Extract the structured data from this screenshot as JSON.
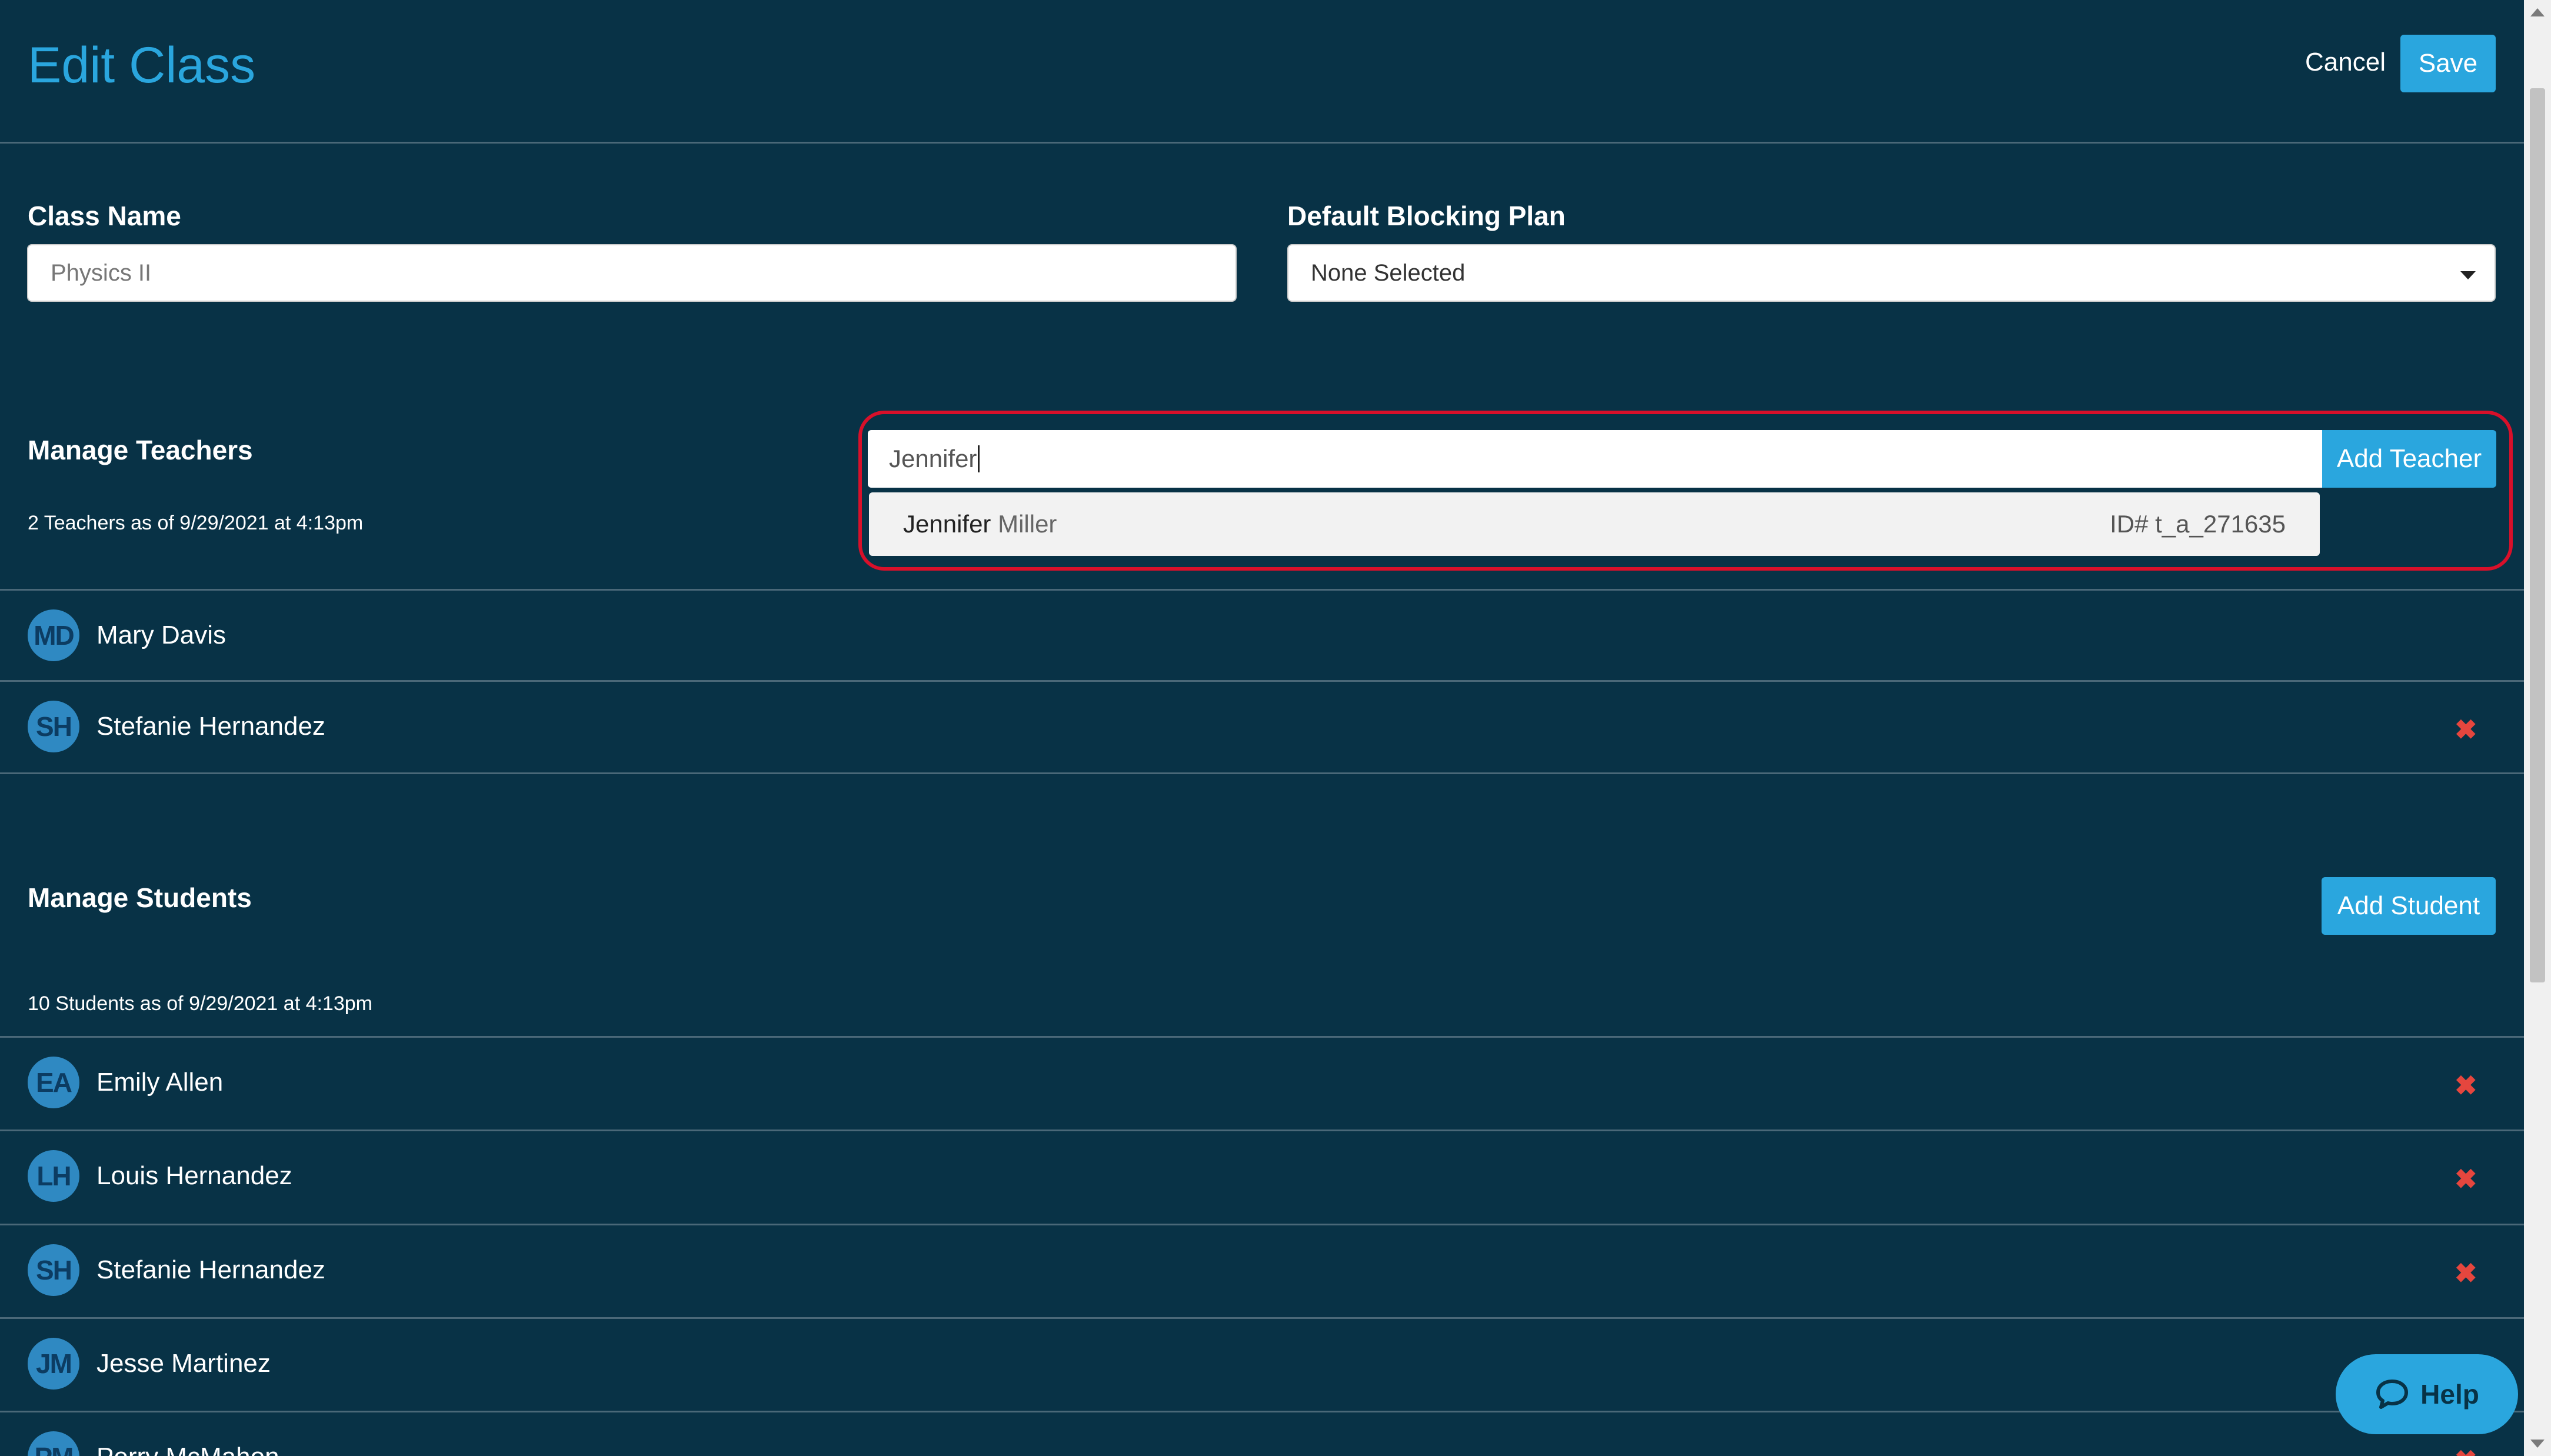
{
  "header": {
    "title": "Edit Class",
    "cancel_label": "Cancel",
    "save_label": "Save"
  },
  "form": {
    "class_name_label": "Class Name",
    "class_name_value": "Physics II",
    "blocking_plan_label": "Default Blocking Plan",
    "blocking_plan_value": "None Selected"
  },
  "teachers": {
    "heading": "Manage Teachers",
    "count_text": "2 Teachers as of 9/29/2021 at 4:13pm",
    "search_value": "Jennifer",
    "add_label": "Add Teacher",
    "suggestion": {
      "match": "Jennifer",
      "rest": " Miller",
      "id": "ID# t_a_271635"
    },
    "list": [
      {
        "initials": "MD",
        "name": "Mary Davis",
        "removable": false
      },
      {
        "initials": "SH",
        "name": "Stefanie Hernandez",
        "removable": true
      }
    ]
  },
  "students": {
    "heading": "Manage Students",
    "count_text": "10 Students as of 9/29/2021 at 4:13pm",
    "add_label": "Add Student",
    "list": [
      {
        "initials": "EA",
        "name": "Emily Allen"
      },
      {
        "initials": "LH",
        "name": "Louis Hernandez"
      },
      {
        "initials": "SH",
        "name": "Stefanie Hernandez"
      },
      {
        "initials": "JM",
        "name": "Jesse Martinez"
      },
      {
        "initials": "PM",
        "name": "Perry McMahon"
      }
    ]
  },
  "remove_symbol": "✖",
  "help_label": "Help",
  "colors": {
    "background": "#083246",
    "accent": "#2aa6de",
    "remove": "#e5463e",
    "highlight": "#d8102a"
  }
}
